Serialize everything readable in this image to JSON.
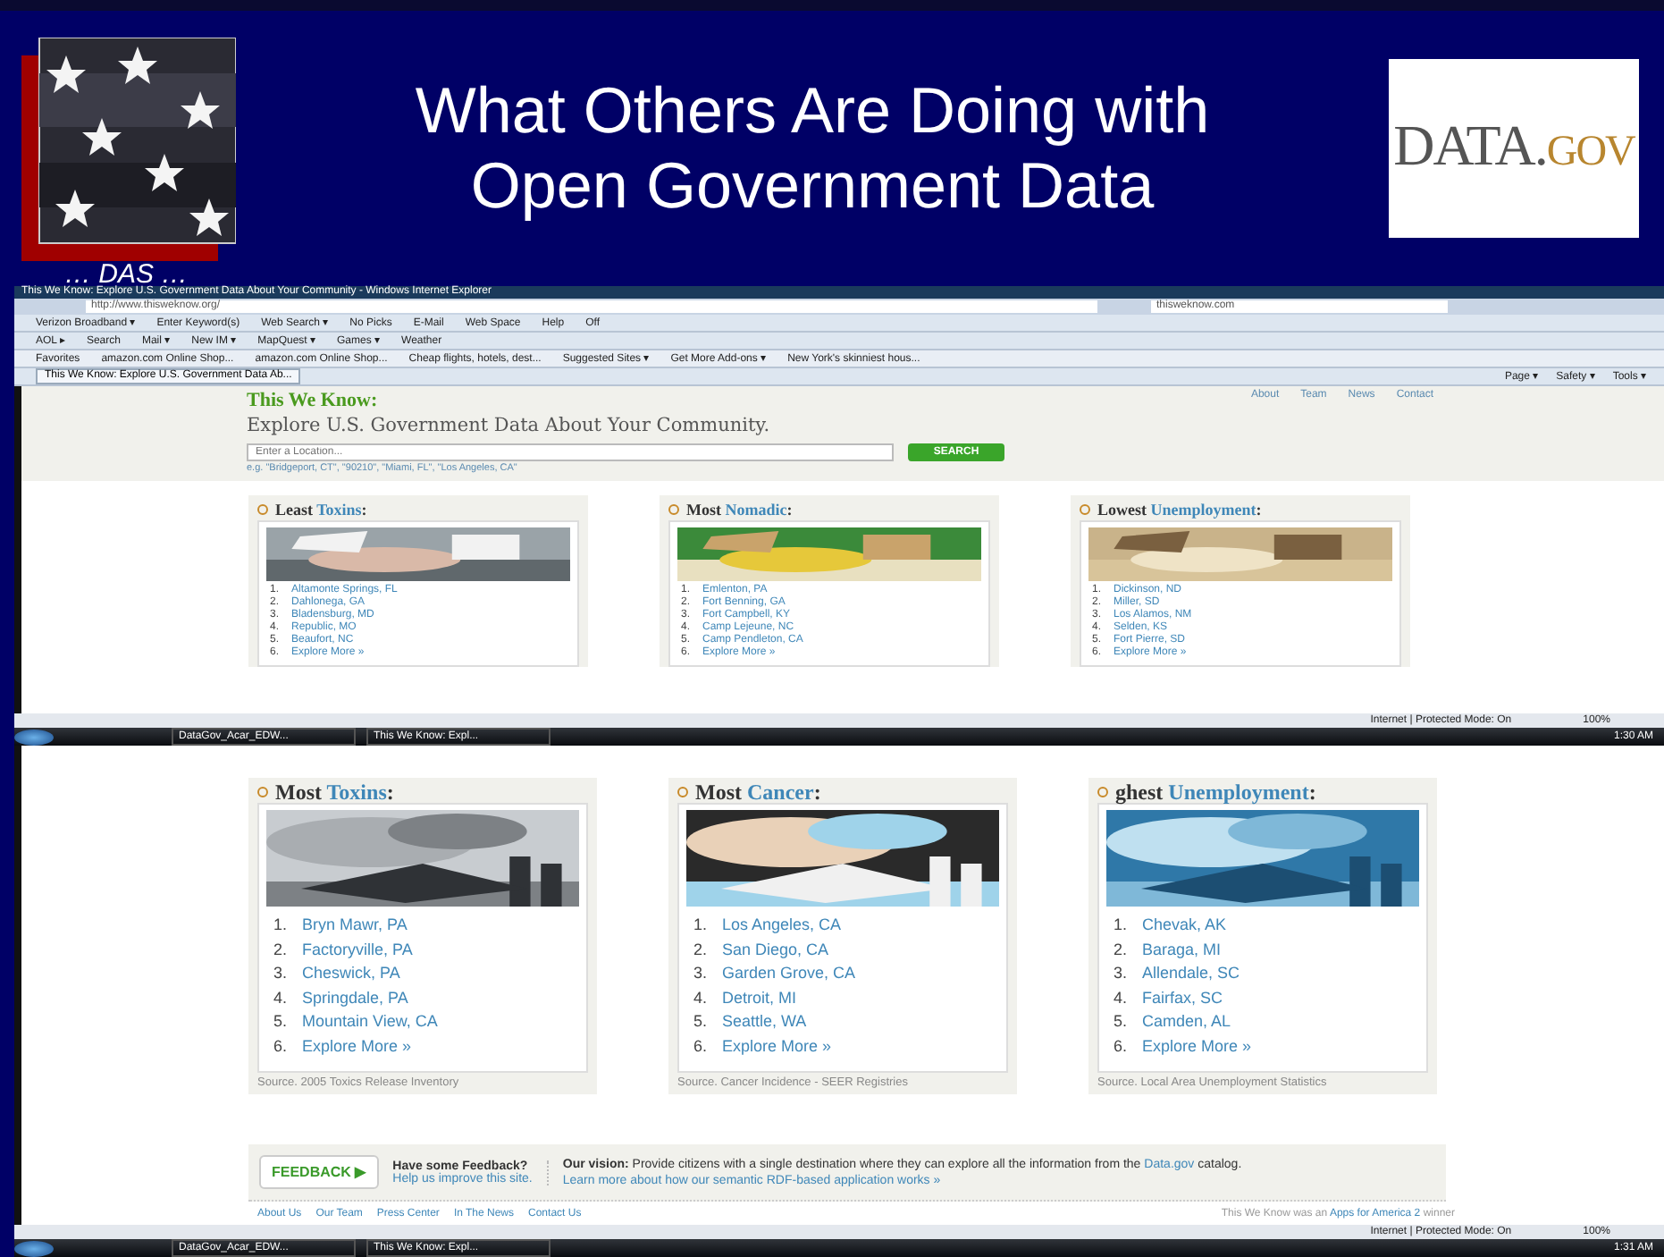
{
  "slide": {
    "title_lines": [
      "What Others Are Doing with",
      "Open Government Data"
    ],
    "caption": "… DAS …",
    "logo": {
      "main": "DATA.",
      "suffix": "GOV"
    }
  },
  "browser": {
    "window_title": "This We Know: Explore U.S. Government Data About Your Community - Windows Internet Explorer",
    "address": "http://www.thisweknow.org/",
    "search_box": "thisweknow.com",
    "toolbar": [
      "Verizon Broadband ▾",
      "Enter Keyword(s)",
      "Web Search ▾",
      "No Picks",
      "E-Mail",
      "Web Space",
      "Help",
      "Off"
    ],
    "aol_bar": [
      "AOL ▸",
      "Search",
      "Mail ▾",
      "New IM ▾",
      "MapQuest ▾",
      "Games ▾",
      "Weather"
    ],
    "favorites": [
      "Favorites",
      "amazon.com Online Shop...",
      "amazon.com Online Shop...",
      "Cheap flights, hotels, dest...",
      "Suggested Sites ▾",
      "Get More Add-ons ▾",
      "New York's skinniest hous..."
    ],
    "tab": "This We Know: Explore U.S. Government Data Ab...",
    "commands": [
      "Page ▾",
      "Safety ▾",
      "Tools ▾"
    ]
  },
  "top_page": {
    "brand": "This We Know:",
    "nav": [
      "About",
      "Team",
      "News",
      "Contact"
    ],
    "headline": "Explore U.S. Government Data About Your Community.",
    "search": {
      "placeholder": "Enter a Location...",
      "button": "SEARCH"
    },
    "examples": "e.g. \"Bridgeport, CT\", \"90210\", \"Miami, FL\", \"Los Angeles, CA\"",
    "cards": [
      {
        "prefix": "Least",
        "topic": "Toxins",
        "end": ":",
        "numbers": [
          "1.",
          "2.",
          "3.",
          "4.",
          "5.",
          "6."
        ],
        "items": [
          "Altamonte Springs, FL",
          "Dahlonega, GA",
          "Bladensburg, MD",
          "Republic, MO",
          "Beaufort, NC",
          "Explore More »"
        ]
      },
      {
        "prefix": "Most",
        "topic": "Nomadic",
        "end": ":",
        "numbers": [
          "1.",
          "2.",
          "3.",
          "4.",
          "5.",
          "6."
        ],
        "items": [
          "Emlenton, PA",
          "Fort Benning, GA",
          "Fort Campbell, KY",
          "Camp Lejeune, NC",
          "Camp Pendleton, CA",
          "Explore More »"
        ]
      },
      {
        "prefix": "Lowest",
        "topic": "Unemployment",
        "end": ":",
        "numbers": [
          "1.",
          "2.",
          "3.",
          "4.",
          "5.",
          "6."
        ],
        "items": [
          "Dickinson, ND",
          "Miller, SD",
          "Los Alamos, NM",
          "Selden, KS",
          "Fort Pierre, SD",
          "Explore More »"
        ]
      }
    ]
  },
  "top_status": {
    "text": "Internet | Protected Mode: On",
    "zoom": "100%"
  },
  "top_taskbar": {
    "buttons": [
      "DataGov_Acar_EDW...",
      "This We Know: Expl..."
    ],
    "clock": "1:30 AM"
  },
  "bottom_page": {
    "cards": [
      {
        "prefix": "Most",
        "topic": "Toxins",
        "end": ":",
        "numbers": [
          "1.",
          "2.",
          "3.",
          "4.",
          "5.",
          "6."
        ],
        "items": [
          "Bryn Mawr, PA",
          "Factoryville, PA",
          "Cheswick, PA",
          "Springdale, PA",
          "Mountain View, CA",
          "Explore More »"
        ],
        "source": "Source. 2005 Toxics Release Inventory"
      },
      {
        "prefix": "Most",
        "topic": "Cancer",
        "end": ":",
        "numbers": [
          "1.",
          "2.",
          "3.",
          "4.",
          "5.",
          "6."
        ],
        "items": [
          "Los Angeles, CA",
          "San Diego, CA",
          "Garden Grove, CA",
          "Detroit, MI",
          "Seattle, WA",
          "Explore More »"
        ],
        "source": "Source. Cancer Incidence - SEER Registries"
      },
      {
        "prefix": "ghest",
        "topic": "Unemployment",
        "end": ":",
        "numbers": [
          "1.",
          "2.",
          "3.",
          "4.",
          "5.",
          "6."
        ],
        "items": [
          "Chevak, AK",
          "Baraga, MI",
          "Allendale, SC",
          "Fairfax, SC",
          "Camden, AL",
          "Explore More »"
        ],
        "source": "Source. Local Area Unemployment Statistics"
      }
    ],
    "feedback": {
      "button": "FEEDBACK ▶",
      "title": "Have some Feedback?",
      "link": "Help us improve this site.",
      "vision_label": "Our vision:",
      "vision_text": "Provide citizens with a single destination where they can explore all the information from the",
      "vision_link": "Data.gov",
      "vision_after": "catalog.",
      "learn_more": "Learn more about how our semantic RDF-based application works »"
    },
    "footer_links": [
      "About Us",
      "Our Team",
      "Press Center",
      "In The News",
      "Contact Us"
    ],
    "footer_note": "This We Know was an",
    "footer_note_link": "Apps for America 2",
    "footer_note_end": "winner"
  },
  "bottom_status": {
    "text": "Internet | Protected Mode: On",
    "zoom": "100%"
  },
  "bottom_taskbar": {
    "buttons": [
      "DataGov_Acar_EDW...",
      "This We Know: Expl..."
    ],
    "clock": "1:31 AM"
  }
}
